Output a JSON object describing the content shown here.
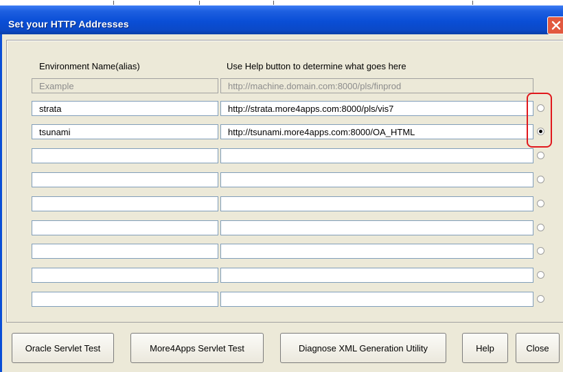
{
  "window": {
    "title": "Set your HTTP Addresses"
  },
  "headers": {
    "name": "Environment Name(alias)",
    "url": "Use Help button to determine what goes here"
  },
  "example": {
    "name": "Example",
    "url": "http://machine.domain.com:8000/pls/finprod"
  },
  "rows": [
    {
      "name": "strata",
      "url": "http://strata.more4apps.com:8000/pls/vis7",
      "selected": false
    },
    {
      "name": "tsunami",
      "url": "http://tsunami.more4apps.com:8000/OA_HTML",
      "selected": true
    },
    {
      "name": "",
      "url": "",
      "selected": false
    },
    {
      "name": "",
      "url": "",
      "selected": false
    },
    {
      "name": "",
      "url": "",
      "selected": false
    },
    {
      "name": "",
      "url": "",
      "selected": false
    },
    {
      "name": "",
      "url": "",
      "selected": false
    },
    {
      "name": "",
      "url": "",
      "selected": false
    },
    {
      "name": "",
      "url": "",
      "selected": false
    }
  ],
  "buttons": {
    "oracle_servlet_test": "Oracle Servlet Test",
    "more4apps_servlet_test": "More4Apps Servlet Test",
    "diagnose_xml": "Diagnose XML Generation Utility",
    "help": "Help",
    "close": "Close"
  },
  "icons": {
    "close": "close-icon"
  },
  "colors": {
    "titlebar": "#0a4ed6",
    "highlight": "#e0161b",
    "close_button": "#e2593f"
  }
}
